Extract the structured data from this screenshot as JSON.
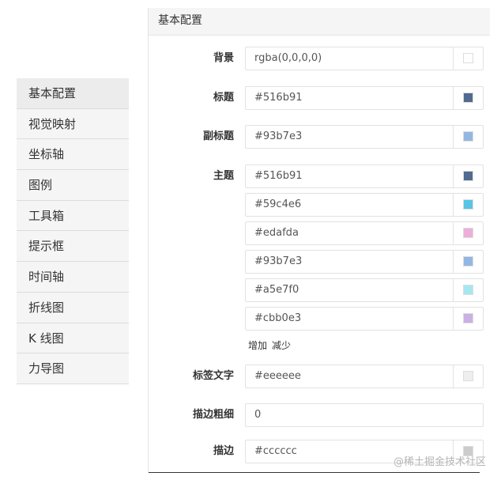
{
  "sidebar": {
    "items": [
      {
        "label": "基本配置"
      },
      {
        "label": "视觉映射"
      },
      {
        "label": "坐标轴"
      },
      {
        "label": "图例"
      },
      {
        "label": "工具箱"
      },
      {
        "label": "提示框"
      },
      {
        "label": "时间轴"
      },
      {
        "label": "折线图"
      },
      {
        "label": "K 线图"
      },
      {
        "label": "力导图"
      }
    ]
  },
  "panel": {
    "title": "基本配置",
    "background": {
      "label": "背景",
      "value": "rgba(0,0,0,0)",
      "swatch": "transparent"
    },
    "title_color": {
      "label": "标题",
      "value": "#516b91",
      "swatch": "#516b91"
    },
    "subtitle_color": {
      "label": "副标题",
      "value": "#93b7e3",
      "swatch": "#93b7e3"
    },
    "theme": {
      "label": "主题",
      "colors": [
        {
          "value": "#516b91",
          "swatch": "#516b91"
        },
        {
          "value": "#59c4e6",
          "swatch": "#59c4e6"
        },
        {
          "value": "#edafda",
          "swatch": "#edafda"
        },
        {
          "value": "#93b7e3",
          "swatch": "#93b7e3"
        },
        {
          "value": "#a5e7f0",
          "swatch": "#a5e7f0"
        },
        {
          "value": "#cbb0e3",
          "swatch": "#cbb0e3"
        }
      ],
      "add_label": "增加",
      "remove_label": "减少"
    },
    "label_text": {
      "label": "标签文字",
      "value": "#eeeeee",
      "swatch": "#eeeeee"
    },
    "border_width": {
      "label": "描边粗细",
      "value": "0"
    },
    "border_color": {
      "label": "描边",
      "value": "#cccccc",
      "swatch": "#cccccc"
    }
  },
  "watermark": "@稀土掘金技术社区"
}
